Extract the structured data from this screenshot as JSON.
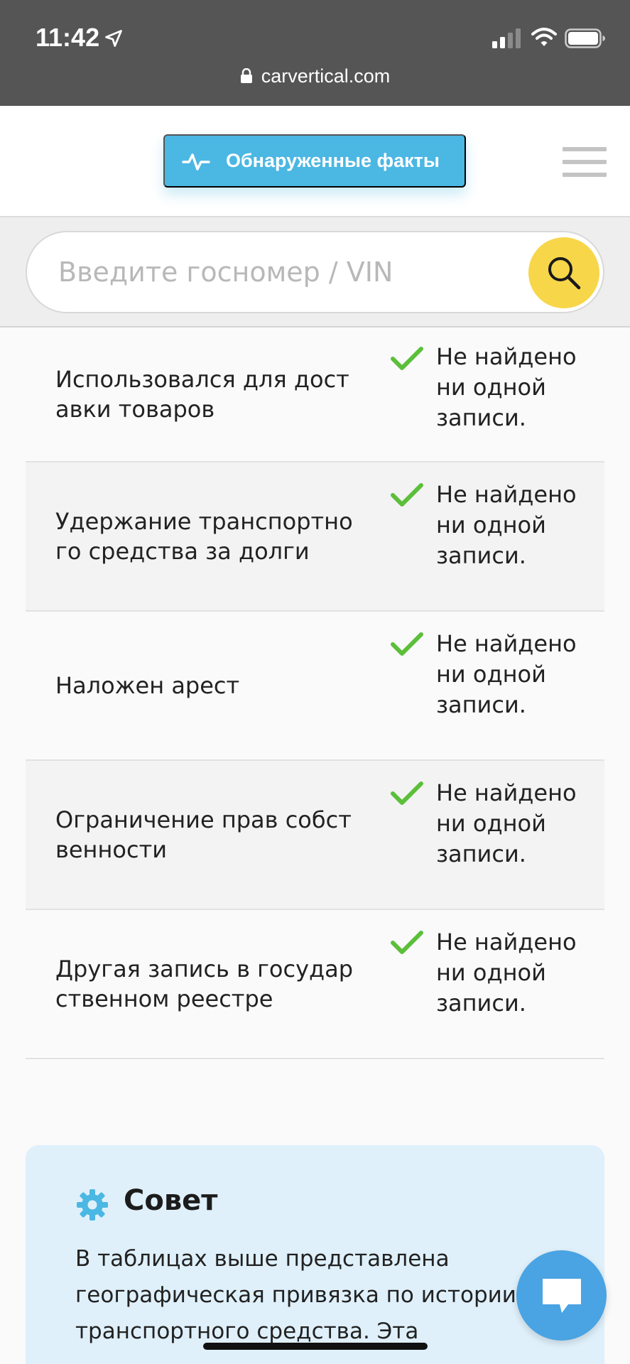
{
  "status_bar": {
    "time": "11:42",
    "url": "carvertical.com"
  },
  "header": {
    "facts_button_label": "Обнаруженные факты"
  },
  "search": {
    "placeholder": "Введите госномер / VIN"
  },
  "rows": [
    {
      "label": "Использовался для доставки товаров",
      "value": "Не найдено ни одной записи."
    },
    {
      "label": "Удержание транспортного средства за долги",
      "value": "Не найдено ни одной записи."
    },
    {
      "label": "Наложен арест",
      "value": "Не найдено ни одной записи."
    },
    {
      "label": "Ограничение прав собственности",
      "value": "Не найдено ни одной записи."
    },
    {
      "label": "Другая запись в государственном реестре",
      "value": "Не найдено ни одной записи."
    }
  ],
  "tip": {
    "title": "Совет",
    "text_line_1": "В таблицах выше представлена",
    "text_line_2": "географическая привязка по истории",
    "text_line_3": "транспортного средства. Эта"
  },
  "colors": {
    "accent_blue": "#4bb7e3",
    "search_yellow": "#f7d64a",
    "check_green": "#5cbf3a",
    "tip_bg": "#dff0fb",
    "chat_blue": "#4aa3e2"
  },
  "icons": {
    "location": "location-arrow-icon",
    "signal": "signal-bars-icon",
    "wifi": "wifi-icon",
    "battery": "battery-icon",
    "lock": "lock-icon",
    "facts": "pulse-icon",
    "menu": "hamburger-menu-icon",
    "search": "search-icon",
    "check": "check-icon",
    "tip": "gear-icon",
    "chat": "chat-icon"
  }
}
